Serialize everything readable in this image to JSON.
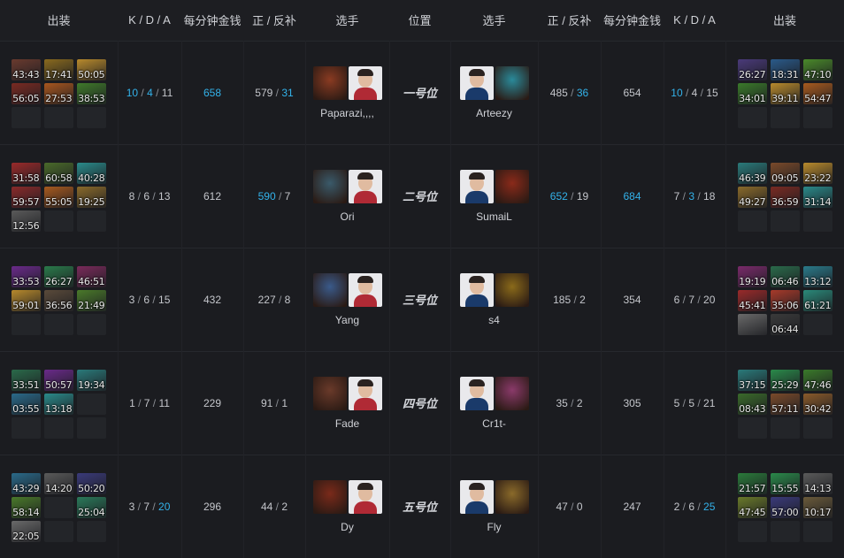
{
  "headers": {
    "items_left": "出装",
    "kda_left": "K / D / A",
    "gpm_left": "每分钟金钱",
    "lhd_left": "正 / 反补",
    "player_left": "选手",
    "position": "位置",
    "player_right": "选手",
    "lhd_right": "正 / 反补",
    "gpm_right": "每分钟金钱",
    "kda_right": "K / D / A",
    "items_right": "出装"
  },
  "rows": [
    {
      "position": "一号位",
      "left": {
        "items": [
          {
            "time": "43:43",
            "color": "#6a3a2e"
          },
          {
            "time": "17:41",
            "color": "#8a6a1e"
          },
          {
            "time": "50:05",
            "color": "#b88a2c"
          },
          {
            "time": "56:05",
            "color": "#7a2a22"
          },
          {
            "time": "27:53",
            "color": "#a8561e"
          },
          {
            "time": "38:53",
            "color": "#3f7a2a"
          }
        ],
        "kda": {
          "k": "10",
          "d": "4",
          "a": "11"
        },
        "k_blue": true,
        "d_blue": true,
        "a_blue": false,
        "gpm": "658",
        "gpm_blue": true,
        "lh": "579",
        "dn": "31",
        "lh_blue": false,
        "dn_blue": true,
        "player": "Paparazi,,,,",
        "hero_color": "#8a3b22",
        "player_color": "#b02a35"
      },
      "right": {
        "items": [
          {
            "time": "26:27",
            "color": "#4a3a7a"
          },
          {
            "time": "18:31",
            "color": "#2a5a8a"
          },
          {
            "time": "47:10",
            "color": "#4a8a2a"
          },
          {
            "time": "34:01",
            "color": "#3a7a2a"
          },
          {
            "time": "39:11",
            "color": "#b88a2c"
          },
          {
            "time": "54:47",
            "color": "#a85a1e"
          }
        ],
        "kda": {
          "k": "10",
          "d": "4",
          "a": "15"
        },
        "k_blue": true,
        "d_blue": false,
        "a_blue": false,
        "gpm": "654",
        "gpm_blue": false,
        "lh": "485",
        "dn": "36",
        "lh_blue": false,
        "dn_blue": true,
        "player": "Arteezy",
        "hero_color": "#2a8a9a",
        "player_color": "#1a3a6a"
      }
    },
    {
      "position": "二号位",
      "left": {
        "items": [
          {
            "time": "31:58",
            "color": "#9a2a2a"
          },
          {
            "time": "60:58",
            "color": "#4a6a2a"
          },
          {
            "time": "40:28",
            "color": "#2a8a8a"
          },
          {
            "time": "59:57",
            "color": "#8a2a2a"
          },
          {
            "time": "55:05",
            "color": "#a85a1e"
          },
          {
            "time": "19:25",
            "color": "#8a6a2a"
          },
          {
            "time": "12:56",
            "color": "#5a5a5a"
          }
        ],
        "kda": {
          "k": "8",
          "d": "6",
          "a": "13"
        },
        "k_blue": false,
        "d_blue": false,
        "a_blue": false,
        "gpm": "612",
        "gpm_blue": false,
        "lh": "590",
        "dn": "7",
        "lh_blue": true,
        "dn_blue": false,
        "player": "Ori",
        "hero_color": "#3a5a6a",
        "player_color": "#b02a35"
      },
      "right": {
        "items": [
          {
            "time": "46:39",
            "color": "#2a7a7a"
          },
          {
            "time": "09:05",
            "color": "#7a4a2a"
          },
          {
            "time": "23:22",
            "color": "#b88a2c"
          },
          {
            "time": "49:27",
            "color": "#8a6a2a"
          },
          {
            "time": "36:59",
            "color": "#7a2a22"
          },
          {
            "time": "31:14",
            "color": "#2a8a8a"
          }
        ],
        "kda": {
          "k": "7",
          "d": "3",
          "a": "18"
        },
        "k_blue": false,
        "d_blue": true,
        "a_blue": false,
        "gpm": "684",
        "gpm_blue": true,
        "lh": "652",
        "dn": "19",
        "lh_blue": true,
        "dn_blue": false,
        "player": "SumaiL",
        "hero_color": "#8a2a1a",
        "player_color": "#1a3a6a"
      }
    },
    {
      "position": "三号位",
      "left": {
        "items": [
          {
            "time": "33:53",
            "color": "#6a2a8a"
          },
          {
            "time": "26:27",
            "color": "#2a7a4a"
          },
          {
            "time": "46:51",
            "color": "#7a2a5a"
          },
          {
            "time": "59:01",
            "color": "#b88a2c"
          },
          {
            "time": "36:56",
            "color": "#5a4a3a"
          },
          {
            "time": "21:49",
            "color": "#4a7a2a"
          }
        ],
        "kda": {
          "k": "3",
          "d": "6",
          "a": "15"
        },
        "k_blue": false,
        "d_blue": false,
        "a_blue": false,
        "gpm": "432",
        "gpm_blue": false,
        "lh": "227",
        "dn": "8",
        "lh_blue": false,
        "dn_blue": false,
        "player": "Yang",
        "hero_color": "#3a5a8a",
        "player_color": "#b02a35"
      },
      "right": {
        "items": [
          {
            "time": "19:19",
            "color": "#7a2a6a"
          },
          {
            "time": "06:46",
            "color": "#2a6a4a"
          },
          {
            "time": "13:12",
            "color": "#2a7a8a"
          },
          {
            "time": "45:41",
            "color": "#9a2a2a"
          },
          {
            "time": "35:06",
            "color": "#a83a2a"
          },
          {
            "time": "61:21",
            "color": "#2a8a7a"
          },
          {
            "time": "",
            "color": "#6a6a6a"
          },
          {
            "time": "06:44",
            "color": "#3a3a3a"
          }
        ],
        "kda": {
          "k": "6",
          "d": "7",
          "a": "20"
        },
        "k_blue": false,
        "d_blue": false,
        "a_blue": false,
        "gpm": "354",
        "gpm_blue": false,
        "lh": "185",
        "dn": "2",
        "lh_blue": false,
        "dn_blue": false,
        "player": "s4",
        "hero_color": "#8a6a1a",
        "player_color": "#1a3a6a"
      }
    },
    {
      "position": "四号位",
      "left": {
        "items": [
          {
            "time": "33:51",
            "color": "#2a6a4a"
          },
          {
            "time": "50:57",
            "color": "#6a2a8a"
          },
          {
            "time": "19:34",
            "color": "#2a7a7a"
          },
          {
            "time": "03:55",
            "color": "#2a6a8a"
          },
          {
            "time": "13:18",
            "color": "#2a8a8a"
          }
        ],
        "kda": {
          "k": "1",
          "d": "7",
          "a": "11"
        },
        "k_blue": false,
        "d_blue": false,
        "a_blue": false,
        "gpm": "229",
        "gpm_blue": false,
        "lh": "91",
        "dn": "1",
        "lh_blue": false,
        "dn_blue": false,
        "player": "Fade",
        "hero_color": "#6a3a2a",
        "player_color": "#b02a35"
      },
      "right": {
        "items": [
          {
            "time": "37:15",
            "color": "#2a7a7a"
          },
          {
            "time": "25:29",
            "color": "#2a8a4a"
          },
          {
            "time": "47:46",
            "color": "#3a7a2a"
          },
          {
            "time": "08:43",
            "color": "#3a6a2a"
          },
          {
            "time": "57:11",
            "color": "#7a4a2a"
          },
          {
            "time": "30:42",
            "color": "#8a5a2a"
          }
        ],
        "kda": {
          "k": "5",
          "d": "5",
          "a": "21"
        },
        "k_blue": false,
        "d_blue": false,
        "a_blue": false,
        "gpm": "305",
        "gpm_blue": false,
        "lh": "35",
        "dn": "2",
        "lh_blue": false,
        "dn_blue": false,
        "player": "Cr1t-",
        "hero_color": "#8a3a6a",
        "player_color": "#1a3a6a"
      }
    },
    {
      "position": "五号位",
      "left": {
        "items": [
          {
            "time": "43:29",
            "color": "#2a6a8a"
          },
          {
            "time": "14:20",
            "color": "#5a5a5a"
          },
          {
            "time": "50:20",
            "color": "#3a3a7a"
          },
          {
            "time": "58:14",
            "color": "#4a7a2a"
          },
          {
            "time": "",
            "color": "#232529",
            "empty": true
          },
          {
            "time": "25:04",
            "color": "#2a7a5a"
          },
          {
            "time": "22:05",
            "color": "#6a6a6a"
          }
        ],
        "kda": {
          "k": "3",
          "d": "7",
          "a": "20"
        },
        "k_blue": false,
        "d_blue": false,
        "a_blue": true,
        "gpm": "296",
        "gpm_blue": false,
        "lh": "44",
        "dn": "2",
        "lh_blue": false,
        "dn_blue": false,
        "player": "Dy",
        "hero_color": "#7a2a1a",
        "player_color": "#b02a35"
      },
      "right": {
        "items": [
          {
            "time": "21:57",
            "color": "#2a7a3a"
          },
          {
            "time": "15:55",
            "color": "#2a8a4a"
          },
          {
            "time": "14:13",
            "color": "#5a5a5a"
          },
          {
            "time": "47:45",
            "color": "#6a7a2a"
          },
          {
            "time": "57:00",
            "color": "#3a3a7a"
          },
          {
            "time": "10:17",
            "color": "#6a5a3a"
          }
        ],
        "kda": {
          "k": "2",
          "d": "6",
          "a": "25"
        },
        "k_blue": false,
        "d_blue": false,
        "a_blue": true,
        "gpm": "247",
        "gpm_blue": false,
        "lh": "47",
        "dn": "0",
        "lh_blue": false,
        "dn_blue": false,
        "player": "Fly",
        "hero_color": "#8a6a2a",
        "player_color": "#1a3a6a"
      }
    }
  ]
}
